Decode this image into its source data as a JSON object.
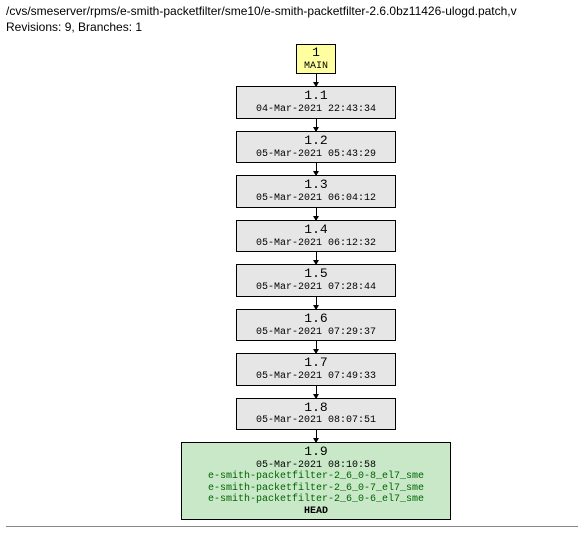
{
  "header": {
    "path": "/cvs/smeserver/rpms/e-smith-packetfilter/sme10/e-smith-packetfilter-2.6.0bz11426-ulogd.patch,v",
    "stats": "Revisions: 9, Branches: 1"
  },
  "branch": {
    "num": "1",
    "name": "MAIN"
  },
  "revisions": [
    {
      "rev": "1.1",
      "date": "04-Mar-2021 22:43:34"
    },
    {
      "rev": "1.2",
      "date": "05-Mar-2021 05:43:29"
    },
    {
      "rev": "1.3",
      "date": "05-Mar-2021 06:04:12"
    },
    {
      "rev": "1.4",
      "date": "05-Mar-2021 06:12:32"
    },
    {
      "rev": "1.5",
      "date": "05-Mar-2021 07:28:44"
    },
    {
      "rev": "1.6",
      "date": "05-Mar-2021 07:29:37"
    },
    {
      "rev": "1.7",
      "date": "05-Mar-2021 07:49:33"
    },
    {
      "rev": "1.8",
      "date": "05-Mar-2021 08:07:51"
    }
  ],
  "head_revision": {
    "rev": "1.9",
    "date": "05-Mar-2021 08:10:58",
    "tags": [
      "e-smith-packetfilter-2_6_0-8_el7_sme",
      "e-smith-packetfilter-2_6_0-7_el7_sme",
      "e-smith-packetfilter-2_6_0-6_el7_sme"
    ],
    "head_label": "HEAD"
  }
}
